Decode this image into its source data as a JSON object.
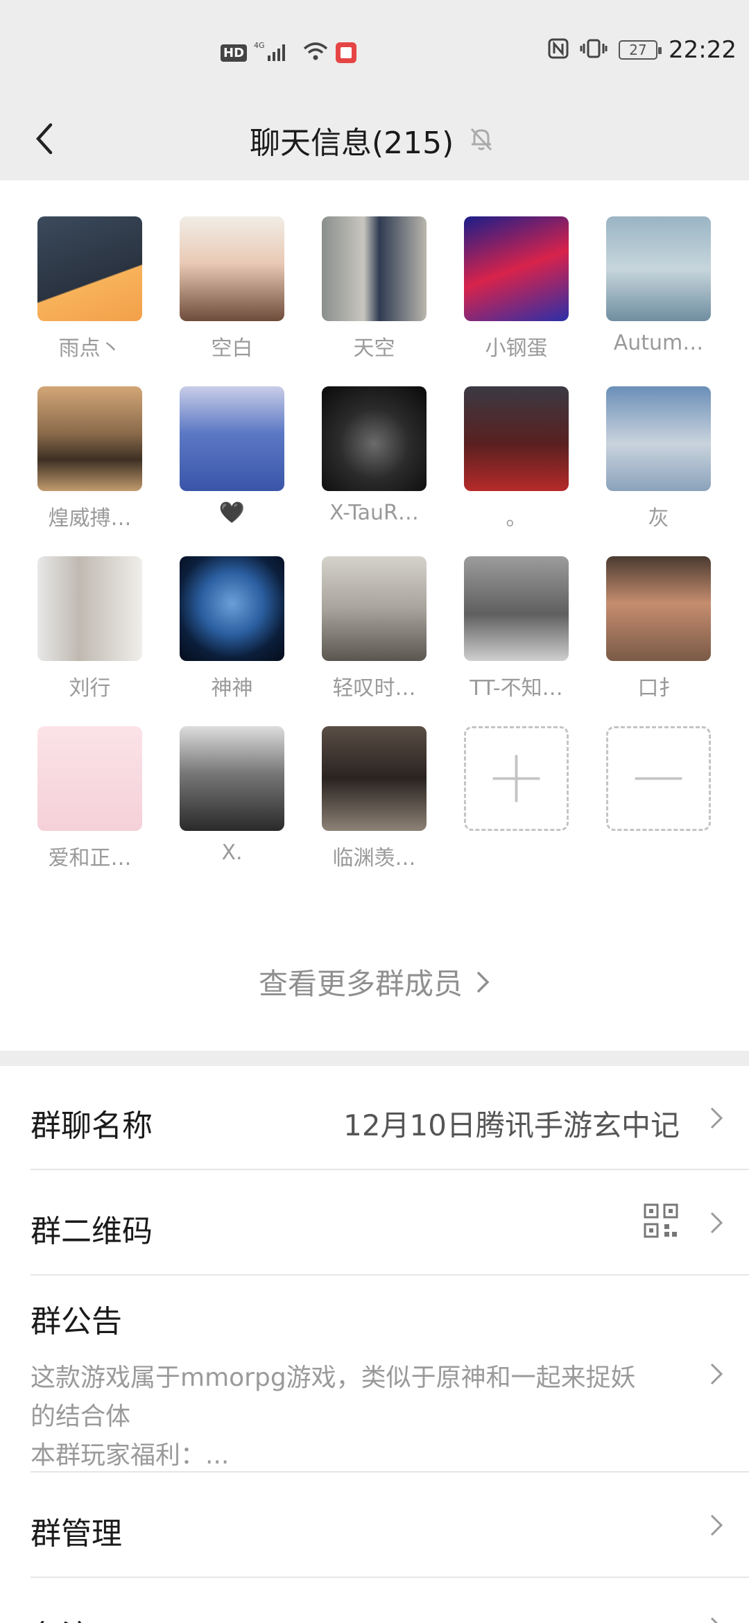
{
  "status_bar": {
    "hd": "HD",
    "network": "4G",
    "time": "22:22",
    "battery": "27"
  },
  "nav": {
    "title": "聊天信息(215)"
  },
  "members": [
    {
      "name": "雨点丶",
      "bg": "linear-gradient(160deg,#3b4a5c 0%,#2a3340 60%,#f7b25a 61%,#f3a04a 100%)"
    },
    {
      "name": "空白",
      "bg": "linear-gradient(180deg,#f1ede6 0%,#e9c9b5 45%,#6e4b3a 100%)"
    },
    {
      "name": "天空",
      "bg": "linear-gradient(90deg,#8a8f8c 0%,#c8c6bf 40%,#2f3b52 55%,#b9b6ad 100%)"
    },
    {
      "name": "小钢蛋",
      "bg": "linear-gradient(160deg,#1a1e8a 0%,#d8234b 50%,#2b2fa8 100%)"
    },
    {
      "name": "Autum…",
      "bg": "linear-gradient(180deg,#9ab4c4 0%,#c7d6dc 50%,#6f8ea0 100%)"
    },
    {
      "name": "煌威搏…",
      "bg": "linear-gradient(180deg,#d3a777 0%,#8a6a4b 45%,#3d3024 70%,#c29b6e 100%)"
    },
    {
      "name": "🖤",
      "bg": "linear-gradient(180deg,#c9cde8 0%,#5b78c4 45%,#3a55a8 100%)"
    },
    {
      "name": "X-TauR…",
      "bg": "radial-gradient(circle at 50% 55%,#6b6b6b 0%,#2b2b2b 45%,#0a0a0a 100%)"
    },
    {
      "name": "。",
      "bg": "linear-gradient(180deg,#3a3a44 0%,#5a2020 55%,#b72a2a 100%)"
    },
    {
      "name": "灰",
      "bg": "linear-gradient(180deg,#6b8fb8 0%,#c9d3dd 55%,#8aa2bb 100%)"
    },
    {
      "name": "刘行",
      "bg": "linear-gradient(90deg,#e8e8e8 0%,#bfb9b1 40%,#f0eeea 100%)"
    },
    {
      "name": "神神",
      "bg": "radial-gradient(circle at 50% 45%,#6aa0d8 0%,#2b5fa1 40%,#0b1e3a 70%,#050c1c 100%)"
    },
    {
      "name": "轻叹时…",
      "bg": "linear-gradient(180deg,#d5d2cc 0%,#a8a39c 50%,#5a5650 100%)"
    },
    {
      "name": "TT-不知…",
      "bg": "linear-gradient(180deg,#9c9c9c 0%,#5f5f5f 55%,#cfcfcf 100%)"
    },
    {
      "name": "口⺘",
      "bg": "linear-gradient(180deg,#4a3a30 0%,#c58d6f 45%,#7a5a47 100%)"
    },
    {
      "name": "爱和正…",
      "bg": "linear-gradient(180deg,#fbe3e8 0%,#f5d0d9 100%)"
    },
    {
      "name": "X.",
      "bg": "linear-gradient(180deg,#ddd 0%,#777 45%,#2a2a2a 100%)"
    },
    {
      "name": "临渊羡…",
      "bg": "linear-gradient(180deg,#5a4e45 0%,#2a2320 50%,#8d8276 100%)"
    }
  ],
  "more_members": "查看更多群成员",
  "group_name_row": {
    "label": "群聊名称",
    "value": "12月10日腾讯手游玄中记"
  },
  "qr_row": {
    "label": "群二维码"
  },
  "notice_row": {
    "label": "群公告",
    "line1": "这款游戏属于mmorpg游戏，类似于原神和一起来捉妖",
    "line2": "的结合体",
    "line3": "本群玩家福利：..."
  },
  "manage_row": {
    "label": "群管理"
  },
  "remark_row": {
    "label": "备注"
  }
}
